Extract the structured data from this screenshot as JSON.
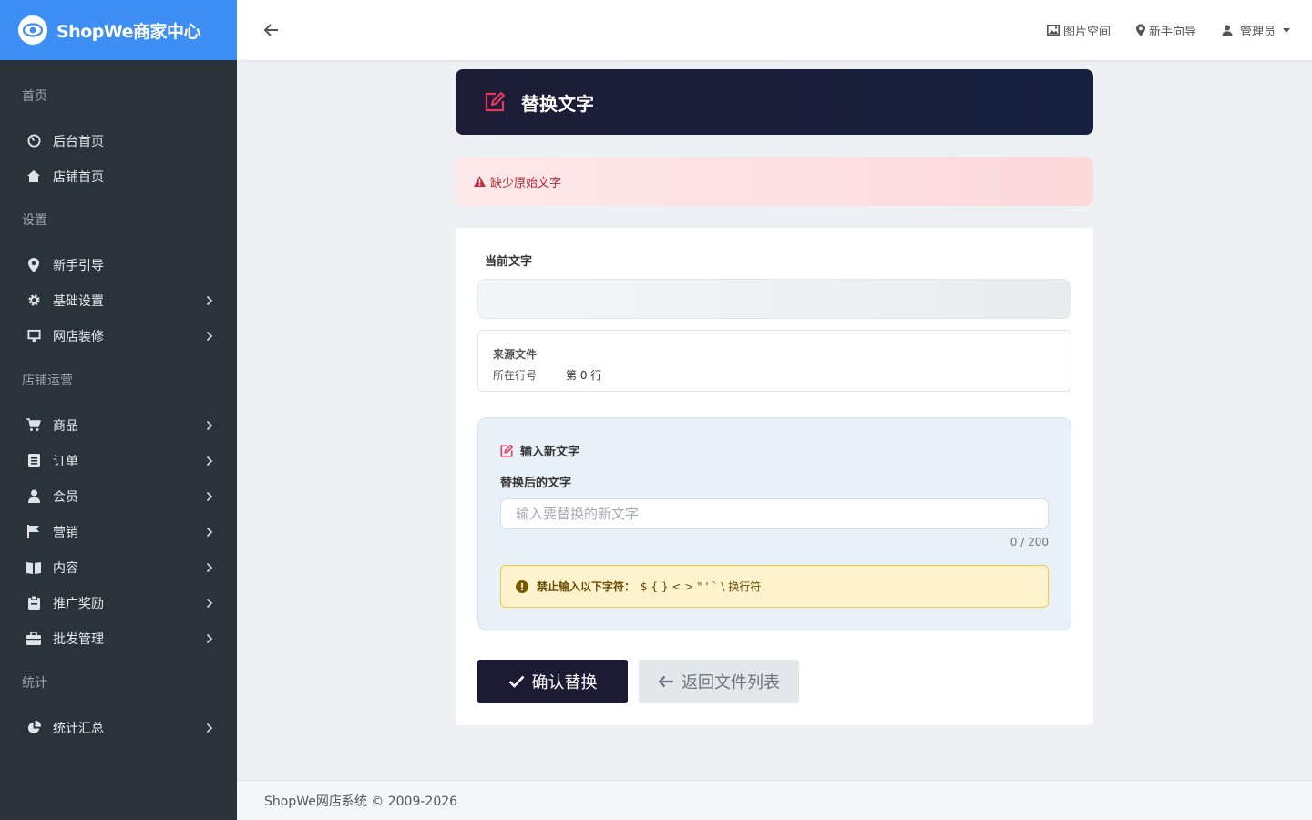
{
  "brand": {
    "title": "ShopWe商家中心"
  },
  "sidebar": {
    "sections": [
      {
        "title": "首页",
        "items": [
          {
            "label": "后台首页",
            "icon": "dashboard-icon",
            "chevron": false
          },
          {
            "label": "店铺首页",
            "icon": "home-icon",
            "chevron": false
          }
        ]
      },
      {
        "title": "设置",
        "items": [
          {
            "label": "新手引导",
            "icon": "map-marker-icon",
            "chevron": false
          },
          {
            "label": "基础设置",
            "icon": "gear-icon",
            "chevron": true
          },
          {
            "label": "网店装修",
            "icon": "monitor-icon",
            "chevron": true
          }
        ]
      },
      {
        "title": "店铺运营",
        "items": [
          {
            "label": "商品",
            "icon": "cart-icon",
            "chevron": true
          },
          {
            "label": "订单",
            "icon": "list-icon",
            "chevron": true
          },
          {
            "label": "会员",
            "icon": "user-icon",
            "chevron": true
          },
          {
            "label": "营销",
            "icon": "flag-icon",
            "chevron": true
          },
          {
            "label": "内容",
            "icon": "book-icon",
            "chevron": true
          },
          {
            "label": "推广奖励",
            "icon": "clipboard-icon",
            "chevron": true
          },
          {
            "label": "批发管理",
            "icon": "briefcase-icon",
            "chevron": true
          }
        ]
      },
      {
        "title": "统计",
        "items": [
          {
            "label": "统计汇总",
            "icon": "pie-chart-icon",
            "chevron": true
          }
        ]
      }
    ]
  },
  "header": {
    "links": [
      {
        "label": "图片空间",
        "icon": "image-icon"
      },
      {
        "label": "新手向导",
        "icon": "map-marker-icon"
      },
      {
        "label": "管理员",
        "icon": "user-icon"
      }
    ]
  },
  "page": {
    "title": "替换文字",
    "error_message": "缺少原始文字",
    "current_text_label": "当前文字",
    "current_text_value": "",
    "source_file_label": "来源文件",
    "source_file_value": "",
    "line_label": "所在行号",
    "line_value": "第 0 行",
    "input_panel_title": "输入新文字",
    "replace_label": "替换后的文字",
    "input_placeholder": "输入要替换的新文字",
    "input_value": "",
    "counter": "0 / 200",
    "warning_title": "禁止输入以下字符：",
    "warning_chars": "$ { } < > \" ' ` \\ 换行符",
    "confirm_button": "确认替换",
    "back_button": "返回文件列表"
  },
  "footer": {
    "text": "ShopWe网店系统 © 2009-2026"
  },
  "colors": {
    "brand": "#3d8ff5",
    "sidebar": "#2a3339",
    "title_card": "#1b1c33",
    "accent_pink": "#e8365d",
    "error_text": "#b02a37",
    "warning_bg": "#fff3cd"
  }
}
